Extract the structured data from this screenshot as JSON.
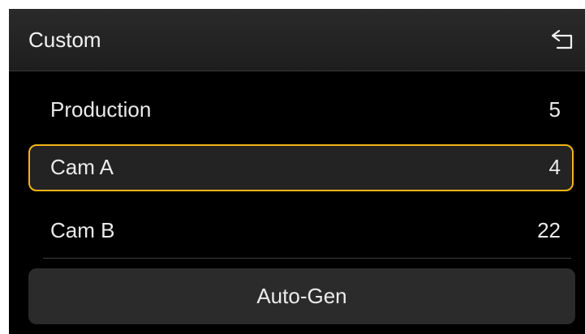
{
  "header": {
    "title": "Custom",
    "back_icon": "return-arrow-icon"
  },
  "list": {
    "items": [
      {
        "label": "Production",
        "value": "5"
      },
      {
        "label": "Cam A",
        "value": "4"
      },
      {
        "label": "Cam B",
        "value": "22"
      }
    ],
    "selected_index": 1
  },
  "actions": {
    "auto_gen_label": "Auto-Gen"
  },
  "colors": {
    "background": "#000000",
    "header_background": "#232323",
    "selection_border": "#f2b418",
    "text": "#eaeaea",
    "button_background": "#2b2b2b"
  }
}
